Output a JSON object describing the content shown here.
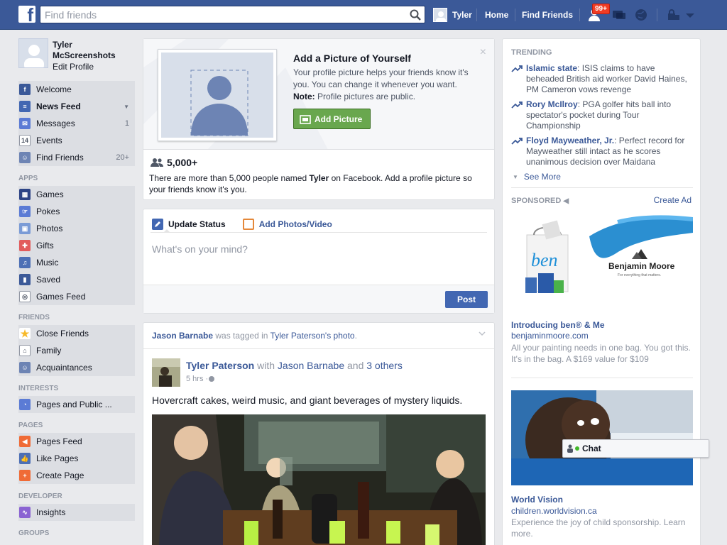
{
  "header": {
    "logo": "f",
    "search_placeholder": "Find friends",
    "user_name": "Tyler",
    "links": [
      "Home",
      "Find Friends"
    ],
    "notification_count": "99+",
    "brand_color": "#3b5998"
  },
  "profile": {
    "name_line1": "Tyler",
    "name_line2": "McScreenshots",
    "edit_label": "Edit Profile"
  },
  "nav": {
    "main": [
      {
        "label": "Welcome",
        "icon": "facebook-icon",
        "count": ""
      },
      {
        "label": "News Feed",
        "icon": "news-feed-icon",
        "count": ""
      },
      {
        "label": "Messages",
        "icon": "messages-icon",
        "count": "1"
      },
      {
        "label": "Events",
        "icon": "calendar-icon",
        "count": ""
      },
      {
        "label": "Find Friends",
        "icon": "find-friends-icon",
        "count": "20+"
      }
    ],
    "apps_title": "APPS",
    "apps": [
      {
        "label": "Games",
        "icon": "games-icon"
      },
      {
        "label": "Pokes",
        "icon": "pokes-icon"
      },
      {
        "label": "Photos",
        "icon": "photos-icon"
      },
      {
        "label": "Gifts",
        "icon": "gift-icon"
      },
      {
        "label": "Music",
        "icon": "music-icon"
      },
      {
        "label": "Saved",
        "icon": "bookmark-icon"
      },
      {
        "label": "Games Feed",
        "icon": "gamepad-icon"
      }
    ],
    "friends_title": "FRIENDS",
    "friends": [
      {
        "label": "Close Friends",
        "icon": "star-icon"
      },
      {
        "label": "Family",
        "icon": "family-icon"
      },
      {
        "label": "Acquaintances",
        "icon": "acquaintances-icon"
      }
    ],
    "interests_title": "INTERESTS",
    "interests": [
      {
        "label": "Pages and Public ...",
        "icon": "rss-icon"
      }
    ],
    "pages_title": "PAGES",
    "pages": [
      {
        "label": "Pages Feed",
        "icon": "megaphone-icon"
      },
      {
        "label": "Like Pages",
        "icon": "thumbs-up-icon"
      },
      {
        "label": "Create Page",
        "icon": "plus-icon"
      }
    ],
    "developer_title": "DEVELOPER",
    "developer": [
      {
        "label": "Insights",
        "icon": "insights-icon"
      }
    ],
    "groups_title": "GROUPS"
  },
  "profile_prompt": {
    "title": "Add a Picture of Yourself",
    "description": "Your profile picture helps your friends know it's you. You can change it whenever you want.",
    "note_label": "Note:",
    "note_text": " Profile pictures are public.",
    "button_label": "Add Picture",
    "close": "×",
    "count": "5,000+",
    "info_pre": "There are more than 5,000 people named ",
    "info_name": "Tyler",
    "info_post": " on Facebook. Add a profile picture so your friends know it's you."
  },
  "composer": {
    "tab_status": "Update Status",
    "tab_photos": "Add Photos/Video",
    "placeholder": "What's on your mind?",
    "post_label": "Post"
  },
  "story": {
    "head_user": "Jason Barnabe",
    "head_mid": " was tagged in ",
    "head_owner": "Tyler Paterson's photo",
    "head_end": ".",
    "author": "Tyler Paterson",
    "with_word": " with ",
    "with_user": "Jason Barnabe",
    "and_word": " and ",
    "others": "3 others",
    "time": "5 hrs · ",
    "text": "Hovercraft cakes, weird music, and giant beverages of mystery liquids."
  },
  "trending": {
    "title": "TRENDING",
    "items": [
      {
        "topic": "Islamic state",
        "text": ": ISIS claims to have beheaded British aid worker David Haines, PM Cameron vows revenge"
      },
      {
        "topic": "Rory McIlroy",
        "text": ": PGA golfer hits ball into spectator's pocket during Tour Championship"
      },
      {
        "topic": "Floyd Mayweather, Jr.",
        "text": ": Perfect record for Mayweather still intact as he scores unanimous decision over Maidana"
      }
    ],
    "see_more": "See More"
  },
  "sponsored": {
    "title": "SPONSORED",
    "create_ad": "Create Ad",
    "ads": [
      {
        "title": "Introducing ben® & Me",
        "url": "benjaminmoore.com",
        "desc": "All your painting needs in one bag. You got this. It's in the bag. A $169 value for $109",
        "brand": "Benjamin Moore",
        "tagline": "For everything that matters.",
        "script": "ben"
      },
      {
        "title": "World Vision",
        "url": "children.worldvision.ca",
        "desc": "Experience the joy of child sponsorship. Learn more."
      }
    ]
  },
  "chat": {
    "label": "Chat"
  }
}
